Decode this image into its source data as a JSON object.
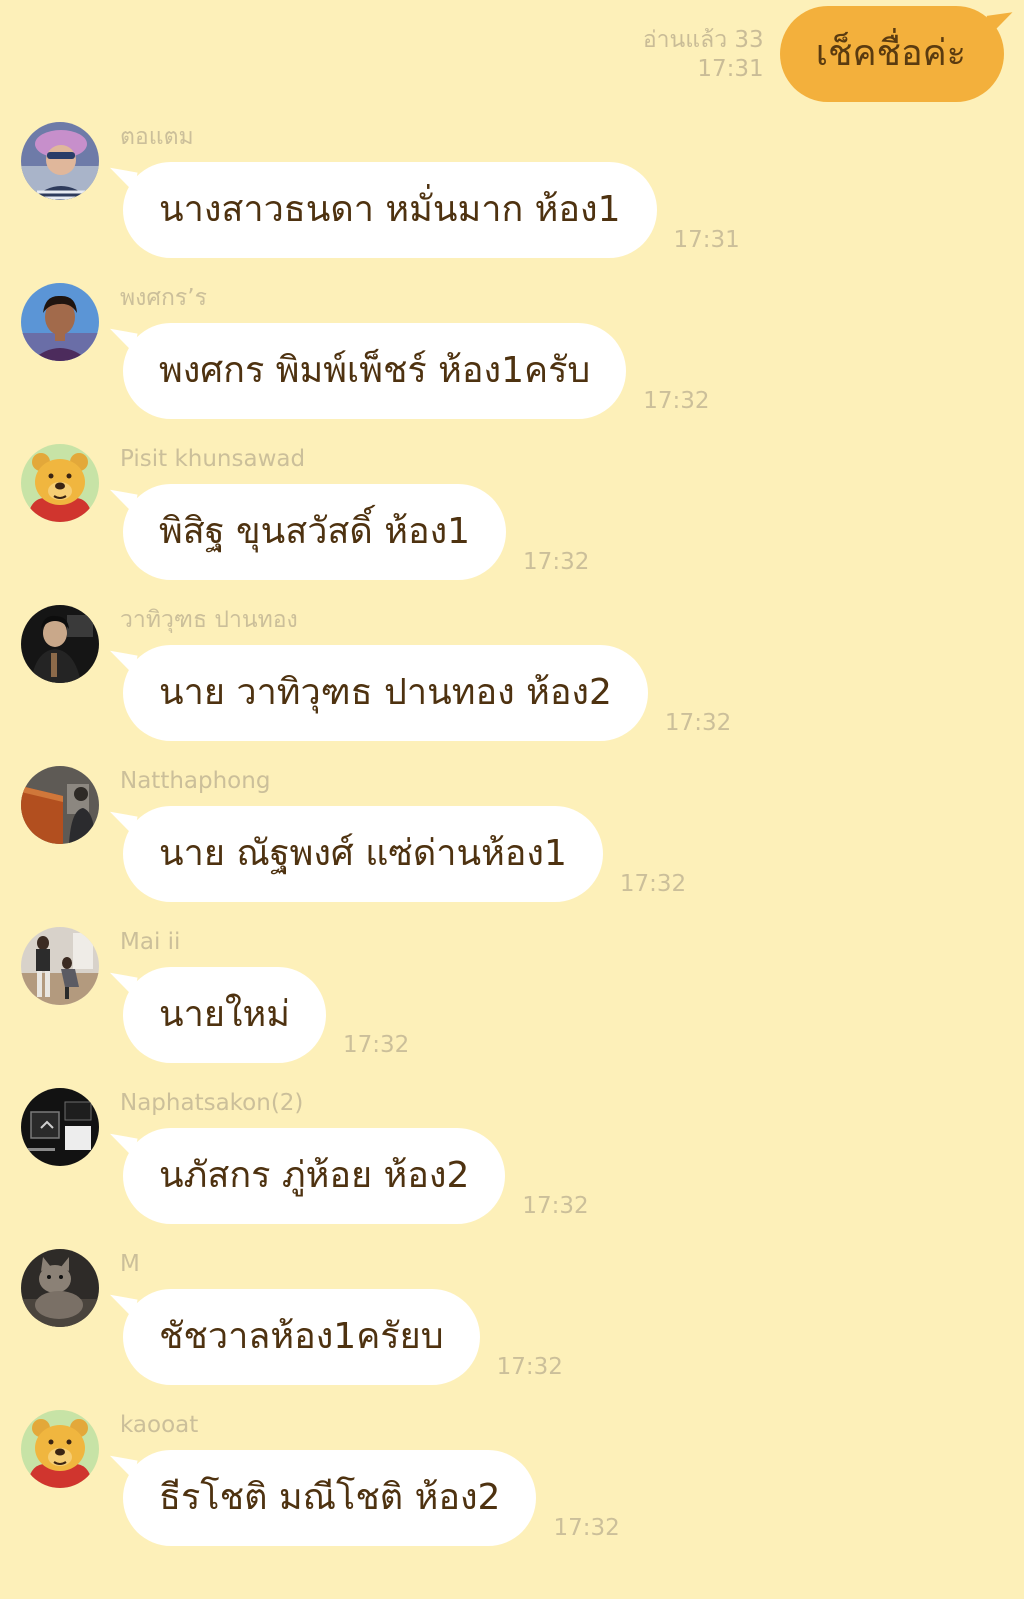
{
  "outgoing": {
    "read_label": "อ่านแล้ว 33",
    "time": "17:31",
    "text": "เช็คชื่อค่ะ"
  },
  "messages": [
    {
      "sender": "ตอแตม",
      "text": "นางสาวธนดา หมั่นมาก ห้อง1",
      "time": "17:31",
      "avatar_icon": "child-photo-avatar-icon"
    },
    {
      "sender": "พงศกร’ร",
      "text": "พงศกร พิมพ์เพ็ชร์ ห้อง1ครับ",
      "time": "17:32",
      "avatar_icon": "portrait-photo-avatar-icon"
    },
    {
      "sender": "Pisit khunsawad",
      "text": "พิสิฐ ขุนสวัสดิ์ ห้อง1",
      "time": "17:32",
      "avatar_icon": "bear-avatar-icon"
    },
    {
      "sender": "วาทิวุฑธ  ปานทอง",
      "text": "นาย วาทิวุฑธ ปานทอง ห้อง2",
      "time": "17:32",
      "avatar_icon": "dark-photo-avatar-icon"
    },
    {
      "sender": "Natthaphong",
      "text": "นาย ณัฐพงศ์ แซ่ด่านห้อง1",
      "time": "17:32",
      "avatar_icon": "piano-photo-avatar-icon"
    },
    {
      "sender": "Mai ii",
      "text": "นายใหม่",
      "time": "17:32",
      "avatar_icon": "room-photo-avatar-icon"
    },
    {
      "sender": "Naphatsakon(2)",
      "text": "นภัสกร ภู่ห้อย ห้อง2",
      "time": "17:32",
      "avatar_icon": "dark-photo-avatar-icon"
    },
    {
      "sender": "M",
      "text": "ชัชวาลห้อง1ครัยบ",
      "time": "17:32",
      "avatar_icon": "cat-photo-avatar-icon"
    },
    {
      "sender": "kaooat",
      "text": "ธีรโชติ มณีโชติ ห้อง2",
      "time": "17:32",
      "avatar_icon": "bear-avatar-icon"
    }
  ],
  "colors": {
    "background": "#FDF0B9",
    "outgoing_bubble": "#F3B03C",
    "incoming_bubble": "#FFFFFF",
    "meta_text": "#CBBF9A",
    "message_text": "#4E3210"
  }
}
